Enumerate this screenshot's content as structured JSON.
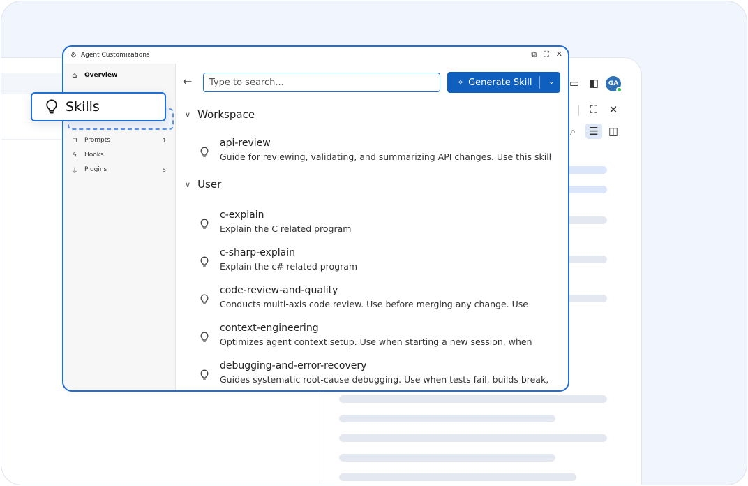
{
  "dialog": {
    "title": "Agent Customizations"
  },
  "sidebar": {
    "items": [
      {
        "label": "Overview",
        "count": ""
      },
      {
        "label": "Prompts",
        "count": "1"
      },
      {
        "label": "Hooks",
        "count": ""
      },
      {
        "label": "Plugins",
        "count": "5"
      }
    ]
  },
  "callout": {
    "label": "Skills"
  },
  "search": {
    "placeholder": "Type to search..."
  },
  "generate_button": {
    "label": "Generate Skill"
  },
  "avatar": {
    "initials": "GA"
  },
  "sections": [
    {
      "title": "Workspace",
      "skills": [
        {
          "name": "api-review",
          "description": "Guide for reviewing, validating, and summarizing API changes. Use this skill"
        }
      ]
    },
    {
      "title": "User",
      "skills": [
        {
          "name": "c-explain",
          "description": "Explain the C related program"
        },
        {
          "name": "c-sharp-explain",
          "description": "Explain the c# related program"
        },
        {
          "name": "code-review-and-quality",
          "description": "Conducts multi-axis code review. Use before merging any change. Use"
        },
        {
          "name": "context-engineering",
          "description": "Optimizes agent context setup. Use when starting a new session, when"
        },
        {
          "name": "debugging-and-error-recovery",
          "description": "Guides systematic root-cause debugging. Use when tests fail, builds break,"
        }
      ]
    }
  ],
  "colors": {
    "accent": "#1f6fd6",
    "button": "#0f5fbf",
    "status_online": "#3fb950"
  }
}
